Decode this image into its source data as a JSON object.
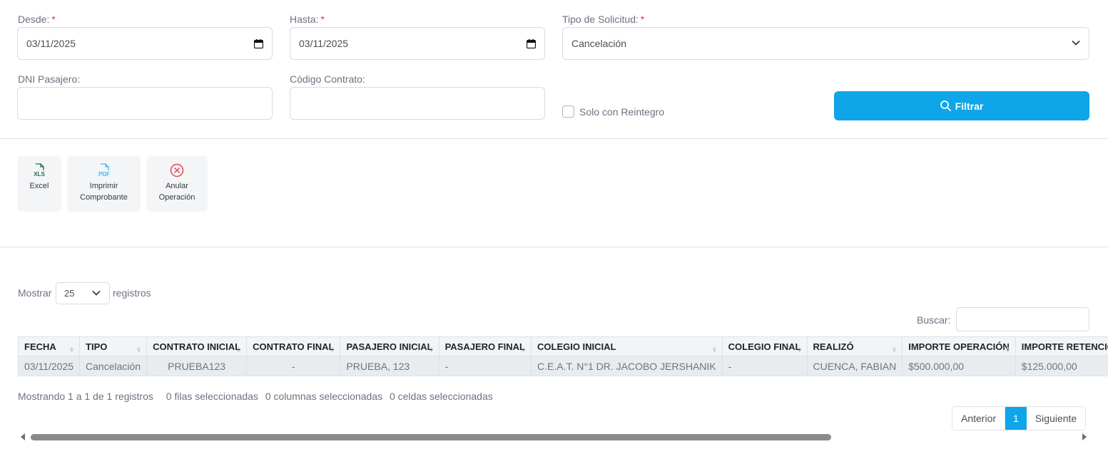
{
  "filters": {
    "desde": {
      "label": "Desde:",
      "required": "*",
      "value": "03/11/2025"
    },
    "hasta": {
      "label": "Hasta:",
      "required": "*",
      "value": "03/11/2025"
    },
    "tipo_solicitud": {
      "label": "Tipo de Solicitud:",
      "required": "*",
      "value": "Cancelación"
    },
    "dni_pasajero": {
      "label": "DNI Pasajero:",
      "value": ""
    },
    "codigo_contrato": {
      "label": "Código Contrato:",
      "value": ""
    },
    "solo_reintegro": {
      "label": "Solo con Reintegro",
      "checked": false
    },
    "filtrar_label": "Filtrar"
  },
  "toolbar": {
    "excel": {
      "label": "Excel",
      "icon": "xls-file-icon",
      "icon_text": "XLS"
    },
    "imprimir": {
      "line1": "Imprimir",
      "line2": "Comprobante",
      "icon": "pdf-file-icon",
      "icon_text": "PDF"
    },
    "anular": {
      "line1": "Anular",
      "line2": "Operación",
      "icon": "cancel-circle-icon"
    }
  },
  "length_menu": {
    "prefix": "Mostrar",
    "value": "25",
    "suffix": "registros"
  },
  "search": {
    "label": "Buscar:",
    "value": ""
  },
  "table": {
    "columns": [
      "FECHA",
      "TIPO",
      "CONTRATO INICIAL",
      "CONTRATO FINAL",
      "PASAJERO INICIAL",
      "PASAJERO FINAL",
      "COLEGIO INICIAL",
      "COLEGIO FINAL",
      "REALIZÓ",
      "IMPORTE OPERACIÓN",
      "IMPORTE RETENCIÓN"
    ],
    "rows": [
      [
        "03/11/2025",
        "Cancelación",
        "PRUEBA123",
        "-",
        "PRUEBA, 123",
        "-",
        "C.E.A.T. N°1 DR. JACOBO JERSHANIK",
        "-",
        "CUENCA, FABIAN",
        "$500.000,00",
        "$125.000,00"
      ]
    ]
  },
  "info": {
    "showing": "Mostrando 1 a 1 de 1 registros",
    "rows_selected": "0 filas seleccionadas",
    "cols_selected": "0 columnas seleccionadas",
    "cells_selected": "0 celdas seleccionadas"
  },
  "pagination": {
    "prev": "Anterior",
    "current": "1",
    "next": "Siguiente"
  },
  "colors": {
    "accent": "#0ea5e9",
    "required": "#dc3545",
    "cancel_icon": "#e5484d",
    "excel_icon": "#1d6f42"
  }
}
